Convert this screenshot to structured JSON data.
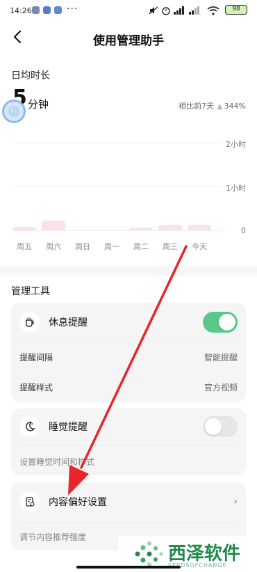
{
  "status_bar": {
    "time": "14:26",
    "more": "···",
    "battery": "98"
  },
  "nav": {
    "title": "使用管理助手"
  },
  "daily": {
    "section_label": "日均时长",
    "value": "5",
    "unit": "分钟",
    "compare_label": "相比前7天",
    "compare_value": "344%"
  },
  "chart_data": {
    "type": "bar",
    "categories": [
      "周五",
      "周六",
      "周日",
      "周一",
      "周二",
      "周三",
      "今天"
    ],
    "values_hours": [
      0.08,
      0.22,
      0,
      0,
      0.06,
      0.12,
      0.12
    ],
    "yticks": [
      "2小时",
      "1小时",
      "0"
    ],
    "ylim": [
      0,
      2
    ]
  },
  "tools": {
    "section_label": "管理工具",
    "rest": {
      "label": "休息提醒",
      "enabled": true,
      "interval_label": "提醒间隔",
      "interval_value": "智能提醒",
      "style_label": "提醒样式",
      "style_value": "官方视频"
    },
    "sleep": {
      "label": "睡觉提醒",
      "enabled": false,
      "hint": "设置睡觉时间和样式"
    },
    "content": {
      "label": "内容偏好设置",
      "hint": "调节内容推荐强度"
    }
  },
  "watermark": {
    "title": "西泽软件",
    "sub": "SEEDSOFCHANGE"
  },
  "colors": {
    "toggle_on": "#59c98b",
    "bar": "#fbe3e5",
    "arrow": "#e8252a"
  }
}
